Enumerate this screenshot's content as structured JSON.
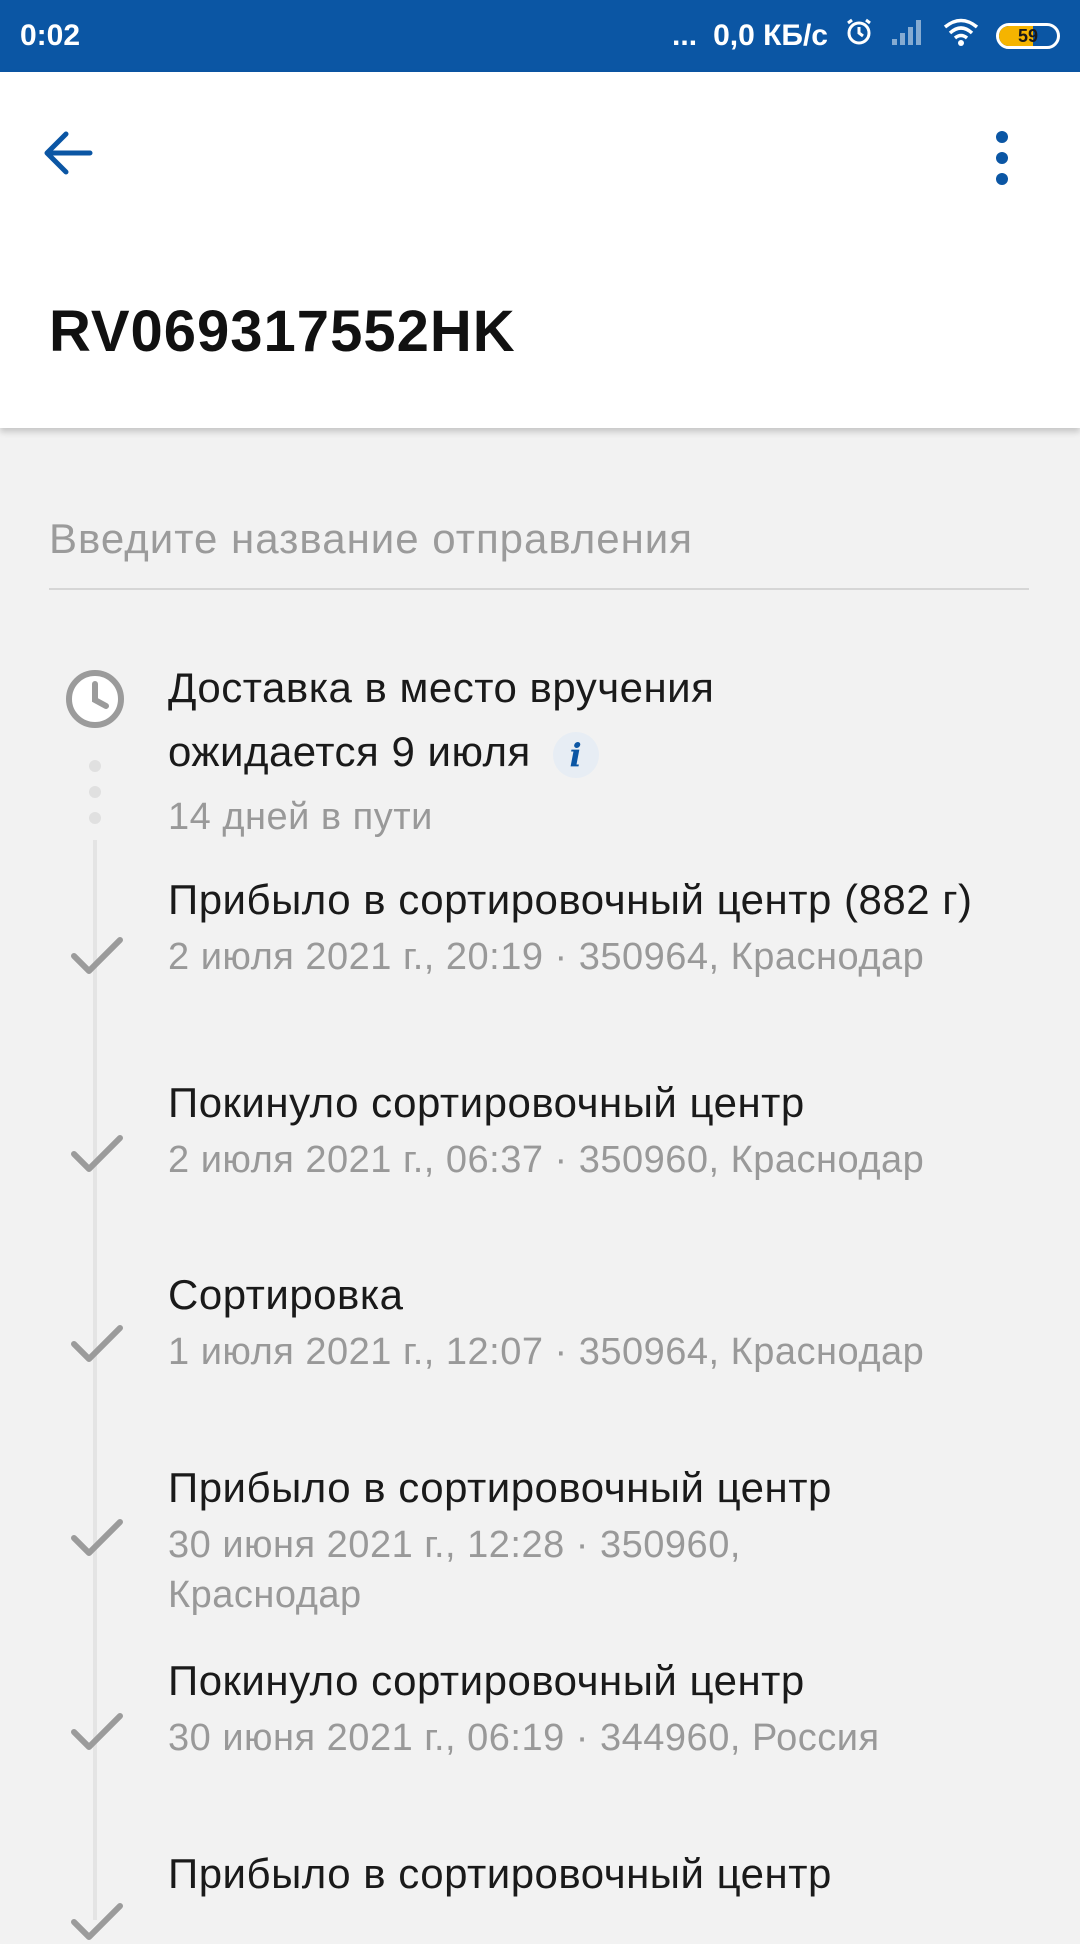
{
  "status_bar": {
    "time": "0:02",
    "dots": "...",
    "network_speed": "0,0 КБ/с",
    "battery_level": "59",
    "icons": [
      "alarm-icon",
      "signal-icon",
      "wifi-icon",
      "battery-icon"
    ]
  },
  "header": {
    "tracking_number": "RV069317552HK",
    "icons": [
      "back-arrow-icon",
      "more-vert-icon"
    ]
  },
  "name_input": {
    "placeholder": "Введите название отправления"
  },
  "delivery": {
    "line1": "Доставка в место вручения",
    "line2": "ожидается 9 июля",
    "transit": "14 дней в пути"
  },
  "events": [
    {
      "title": "Прибыло в сортировочный центр (882 г)",
      "meta": "2 июля 2021 г., 20:19 · 350964, Краснодар"
    },
    {
      "title": "Покинуло сортировочный центр",
      "meta": "2 июля 2021 г., 06:37 · 350960, Краснодар"
    },
    {
      "title": "Сортировка",
      "meta": "1 июля 2021 г., 12:07 · 350964, Краснодар"
    },
    {
      "title": "Прибыло в сортировочный центр",
      "meta": "30 июня 2021 г., 12:28 · 350960, Краснодар"
    },
    {
      "title": "Покинуло сортировочный центр",
      "meta": "30 июня 2021 г., 06:19 · 344960, Россия"
    },
    {
      "title": "Прибыло в сортировочный центр",
      "meta": ""
    }
  ],
  "colors": {
    "primary": "#0b56a4",
    "text_secondary": "#999999",
    "battery": "#f5b400"
  }
}
